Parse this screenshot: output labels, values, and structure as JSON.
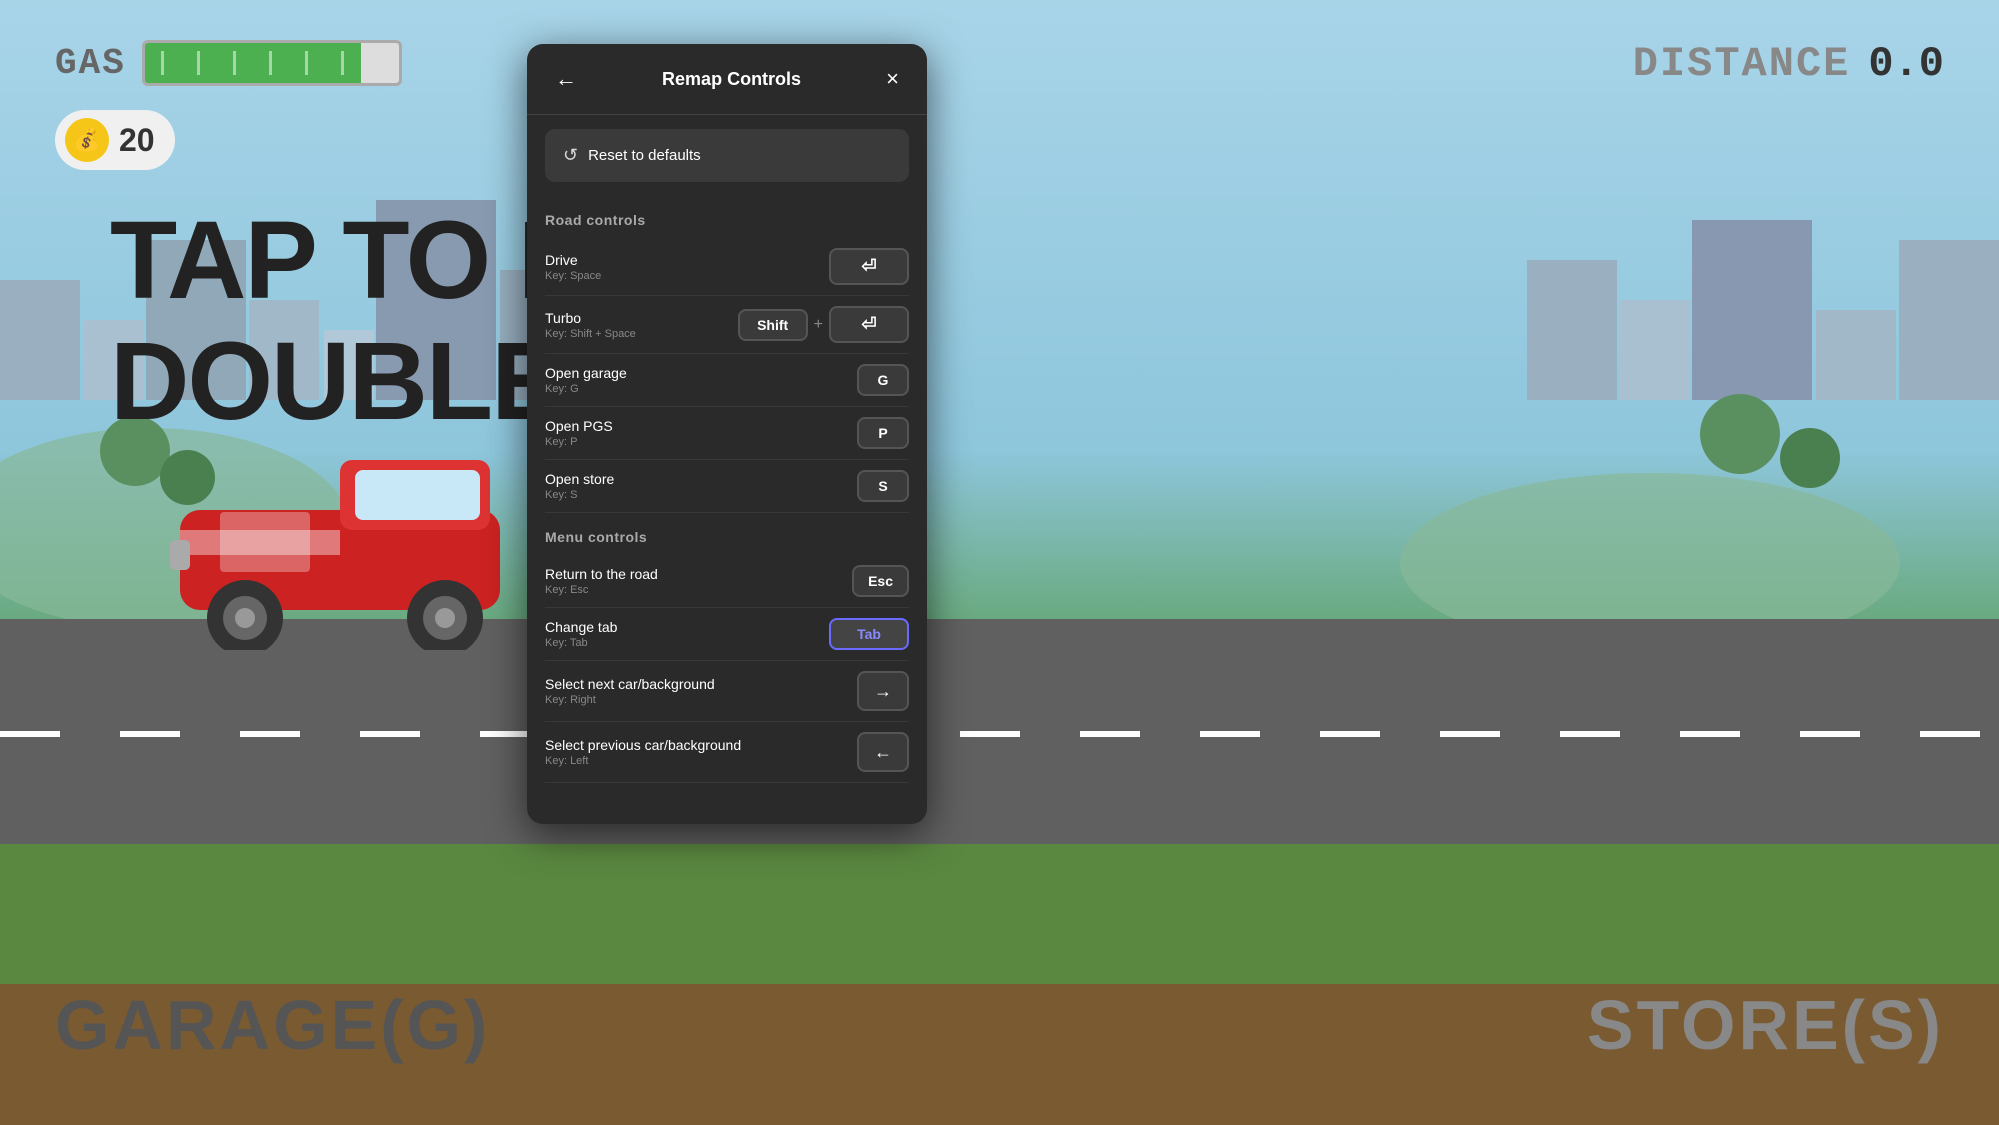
{
  "game": {
    "gas_label": "GAS",
    "distance_label": "DISTANCE",
    "distance_value": "0.0",
    "coin_count": "20",
    "bg_text_line1": "TAP TO D",
    "bg_text_line2": "DOUBLE TAR",
    "garage_label": "GARAGE(G)",
    "store_label": "STORE(S)"
  },
  "modal": {
    "title": "Remap Controls",
    "back_label": "←",
    "close_label": "×",
    "reset_label": "Reset to defaults",
    "reset_icon": "↺",
    "road_controls_header": "Road controls",
    "menu_controls_header": "Menu controls",
    "controls": [
      {
        "name": "Drive",
        "key_hint": "Key: Space",
        "type": "enter",
        "key_label": "⏎",
        "is_combo": false
      },
      {
        "name": "Turbo",
        "key_hint": "Key: Shift + Space",
        "type": "combo",
        "key1_label": "Shift",
        "key2_label": "⏎",
        "is_combo": true
      },
      {
        "name": "Open garage",
        "key_hint": "Key: G",
        "type": "single",
        "key_label": "G",
        "is_combo": false
      },
      {
        "name": "Open PGS",
        "key_hint": "Key: P",
        "type": "single",
        "key_label": "P",
        "is_combo": false
      },
      {
        "name": "Open store",
        "key_hint": "Key: S",
        "type": "single",
        "key_label": "S",
        "is_combo": false
      }
    ],
    "menu_controls": [
      {
        "name": "Return to the road",
        "key_hint": "Key: Esc",
        "type": "single",
        "key_label": "Esc",
        "is_combo": false
      },
      {
        "name": "Change tab",
        "key_hint": "Key: Tab",
        "type": "tab",
        "key_label": "Tab",
        "is_combo": false
      },
      {
        "name": "Select next car/background",
        "key_hint": "Key: Right",
        "type": "arrow",
        "key_label": "→",
        "is_combo": false
      },
      {
        "name": "Select previous car/background",
        "key_hint": "Key: Left",
        "type": "arrow",
        "key_label": "←",
        "is_combo": false
      }
    ]
  },
  "colors": {
    "modal_bg": "#2a2a2a",
    "key_bg": "#3a3a3a",
    "key_border": "#555",
    "section_text": "#aaaaaa",
    "tab_accent": "#6a6aff",
    "tab_text": "#8a8aff"
  }
}
